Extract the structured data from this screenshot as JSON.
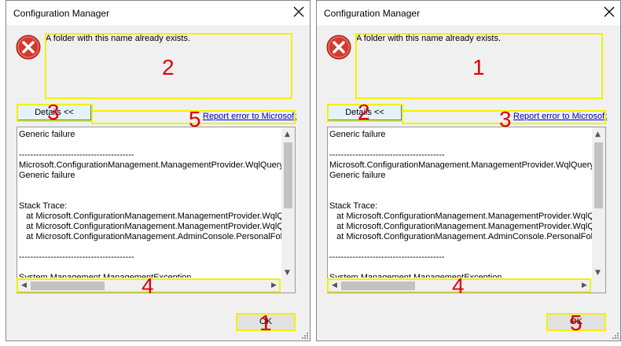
{
  "dialogs": [
    {
      "title": "Configuration Manager",
      "message": "A folder with this name already exists.",
      "details_label": "Details <<",
      "report_link": "Report error to Microsoft",
      "ok_label": "OK",
      "text_lines": [
        "Generic failure",
        "",
        "----------------------------------------",
        "Microsoft.ConfigurationManagement.ManagementProvider.WqlQueryE",
        "Generic failure",
        "",
        "",
        "Stack Trace:",
        "   at Microsoft.ConfigurationManagement.ManagementProvider.WqlQu",
        "   at Microsoft.ConfigurationManagement.ManagementProvider.WqlQu",
        "   at Microsoft.ConfigurationManagement.AdminConsole.PersonalFolde",
        "",
        "----------------------------------------",
        "",
        "System.Management.ManagementException"
      ],
      "annotations": {
        "message": "2",
        "details": "3",
        "report": "5",
        "hscroll": "4",
        "ok": "1"
      }
    },
    {
      "title": "Configuration Manager",
      "message": "A folder with this name already exists.",
      "details_label": "Details <<",
      "report_link": "Report error to Microsoft",
      "ok_label": "OK",
      "text_lines": [
        "Generic failure",
        "",
        "----------------------------------------",
        "Microsoft.ConfigurationManagement.ManagementProvider.WqlQueryE",
        "Generic failure",
        "",
        "",
        "Stack Trace:",
        "   at Microsoft.ConfigurationManagement.ManagementProvider.WqlQu",
        "   at Microsoft.ConfigurationManagement.ManagementProvider.WqlQu",
        "   at Microsoft.ConfigurationManagement.AdminConsole.PersonalFolde",
        "",
        "----------------------------------------",
        "",
        "System.Management.ManagementException"
      ],
      "annotations": {
        "message": "1",
        "details": "2",
        "report": "3",
        "hscroll": "4",
        "ok": "5"
      }
    }
  ],
  "colors": {
    "highlight": "#f2f200",
    "annotation": "#e00000",
    "link": "#0000cc",
    "error_icon": "#c42b1c"
  },
  "icons": {
    "close": "close-icon",
    "error": "error-icon",
    "grip": "resize-grip-icon"
  }
}
